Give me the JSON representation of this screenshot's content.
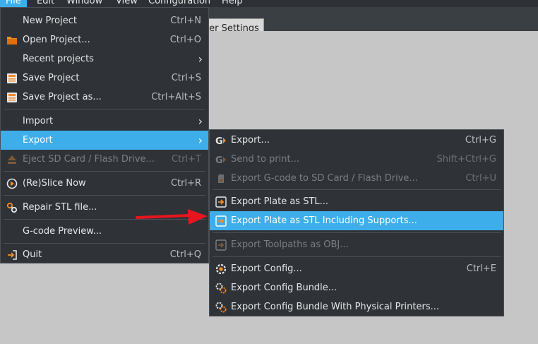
{
  "menubar": {
    "items": [
      "File",
      "Edit",
      "Window",
      "View",
      "Configuration",
      "Help"
    ]
  },
  "tab": {
    "label": "ter Settings"
  },
  "file_menu": {
    "items": [
      {
        "label": "New Project",
        "shortcut": "Ctrl+N",
        "icon": "none"
      },
      {
        "label": "Open Project...",
        "shortcut": "Ctrl+O",
        "icon": "folder-icon"
      },
      {
        "label": "Recent projects",
        "shortcut": "",
        "icon": "none",
        "submenu": true
      },
      {
        "label": "Save Project",
        "shortcut": "Ctrl+S",
        "icon": "save-icon"
      },
      {
        "label": "Save Project as...",
        "shortcut": "Ctrl+Alt+S",
        "icon": "save-as-icon"
      },
      {
        "label": "Import",
        "shortcut": "",
        "icon": "none",
        "submenu": true
      },
      {
        "label": "Export",
        "shortcut": "",
        "icon": "none",
        "submenu": true,
        "highlighted": true
      },
      {
        "label": "Eject SD Card / Flash Drive...",
        "shortcut": "Ctrl+T",
        "icon": "eject-icon",
        "disabled": true
      },
      {
        "label": "(Re)Slice Now",
        "shortcut": "Ctrl+R",
        "icon": "slice-icon"
      },
      {
        "label": "Repair STL file...",
        "shortcut": "",
        "icon": "wrench-icon"
      },
      {
        "label": "G-code Preview...",
        "shortcut": "",
        "icon": "none"
      },
      {
        "label": "Quit",
        "shortcut": "Ctrl+Q",
        "icon": "quit-icon"
      }
    ]
  },
  "export_menu": {
    "items": [
      {
        "label": "Export...",
        "shortcut": "Ctrl+G",
        "icon": "gcode-icon"
      },
      {
        "label": "Send to print...",
        "shortcut": "Shift+Ctrl+G",
        "icon": "gcode-icon",
        "disabled": true
      },
      {
        "label": "Export G-code to SD Card / Flash Drive...",
        "shortcut": "Ctrl+U",
        "icon": "sd-card-icon",
        "disabled": true
      },
      {
        "label": "Export Plate as STL...",
        "shortcut": "",
        "icon": "export-icon"
      },
      {
        "label": "Export Plate as STL Including Supports...",
        "shortcut": "",
        "icon": "export-icon",
        "highlighted": true
      },
      {
        "label": "Export Toolpaths as OBJ...",
        "shortcut": "",
        "icon": "export-icon",
        "disabled": true
      },
      {
        "label": "Export Config...",
        "shortcut": "Ctrl+E",
        "icon": "config-icon"
      },
      {
        "label": "Export Config Bundle...",
        "shortcut": "",
        "icon": "config-bundle-icon"
      },
      {
        "label": "Export Config Bundle With Physical Printers...",
        "shortcut": "",
        "icon": "config-bundle-icon"
      }
    ]
  },
  "colors": {
    "menu_bg": "#2f3338",
    "highlight": "#3daee9",
    "workspace": "#c6c6c6",
    "annotation_arrow": "#e8141e",
    "icon_orange": "#f28c28"
  }
}
